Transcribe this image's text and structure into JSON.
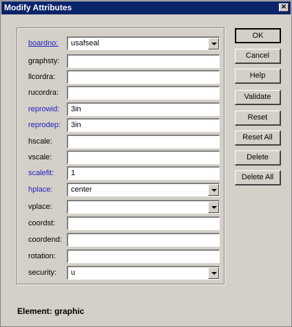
{
  "window": {
    "title": "Modify Attributes",
    "close_glyph": "✕"
  },
  "fields": [
    {
      "label": "boardno:",
      "value": "usafseal",
      "dropdown": true,
      "style": "link-underline"
    },
    {
      "label": "graphsty:",
      "value": "",
      "dropdown": false,
      "style": "normal"
    },
    {
      "label": "llcordra:",
      "value": "",
      "dropdown": false,
      "style": "normal"
    },
    {
      "label": "rucordra:",
      "value": "",
      "dropdown": false,
      "style": "normal"
    },
    {
      "label": "reprowid:",
      "value": "3in",
      "dropdown": false,
      "style": "link"
    },
    {
      "label": "reprodep:",
      "value": "3in",
      "dropdown": false,
      "style": "link"
    },
    {
      "label": "hscale:",
      "value": "",
      "dropdown": false,
      "style": "normal"
    },
    {
      "label": "vscale:",
      "value": "",
      "dropdown": false,
      "style": "normal"
    },
    {
      "label": "scalefit:",
      "value": "1",
      "dropdown": false,
      "style": "link"
    },
    {
      "label": "hplace:",
      "value": "center",
      "dropdown": true,
      "style": "link"
    },
    {
      "label": "vplace:",
      "value": "",
      "dropdown": true,
      "style": "normal"
    },
    {
      "label": "coordst:",
      "value": "",
      "dropdown": false,
      "style": "normal"
    },
    {
      "label": "coordend:",
      "value": "",
      "dropdown": false,
      "style": "normal"
    },
    {
      "label": "rotation:",
      "value": "",
      "dropdown": false,
      "style": "normal"
    },
    {
      "label": "security:",
      "value": "u",
      "dropdown": true,
      "style": "normal"
    }
  ],
  "buttons": {
    "ok": "OK",
    "cancel": "Cancel",
    "help": "Help",
    "validate": "Validate",
    "reset": "Reset",
    "reset_all": "Reset All",
    "delete": "Delete",
    "delete_all": "Delete All"
  },
  "status": {
    "text": "Element: graphic"
  },
  "colors": {
    "titlebar": "#0a246a",
    "link_label": "#2020c0",
    "face": "#d4d0c8"
  }
}
